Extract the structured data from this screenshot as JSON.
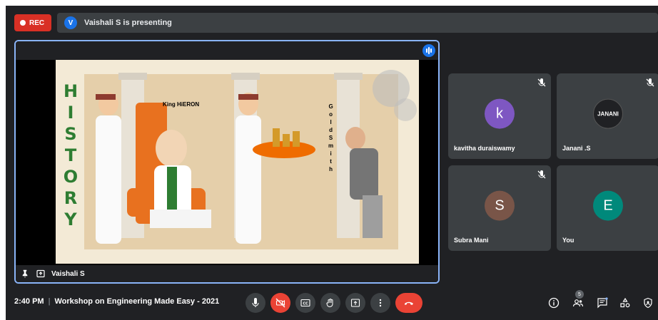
{
  "recording": {
    "label": "REC"
  },
  "presenter_bar": {
    "avatar_letter": "V",
    "text": "Vaishali S is presenting"
  },
  "main_tile": {
    "name": "Vaishali S"
  },
  "slide": {
    "title_letters": [
      "H",
      "I",
      "S",
      "T",
      "O",
      "R",
      "Y"
    ],
    "king_label": "King HiERON",
    "goldsmith_letters": [
      "G",
      "o",
      "l",
      "d",
      "S",
      "m",
      "i",
      "t",
      "h"
    ]
  },
  "participants": [
    {
      "name": "kavitha duraiswamy",
      "initial": "k",
      "color": "#7e57c2"
    },
    {
      "name": "Janani .S",
      "initial": "JANANI",
      "color": "#202124"
    },
    {
      "name": "Subra Mani",
      "initial": "S",
      "color": "#795548"
    },
    {
      "name": "You",
      "initial": "E",
      "color": "#00897b"
    }
  ],
  "meeting": {
    "time": "2:40 PM",
    "separator": "|",
    "title": "Workshop on Engineering Made Easy - 2021"
  },
  "people_count": "5",
  "icons": [
    "mic-icon",
    "camera-off-icon",
    "captions-icon",
    "raise-hand-icon",
    "present-icon",
    "more-icon",
    "hangup-icon",
    "info-icon",
    "people-icon",
    "chat-icon",
    "activities-icon",
    "host-controls-icon"
  ]
}
